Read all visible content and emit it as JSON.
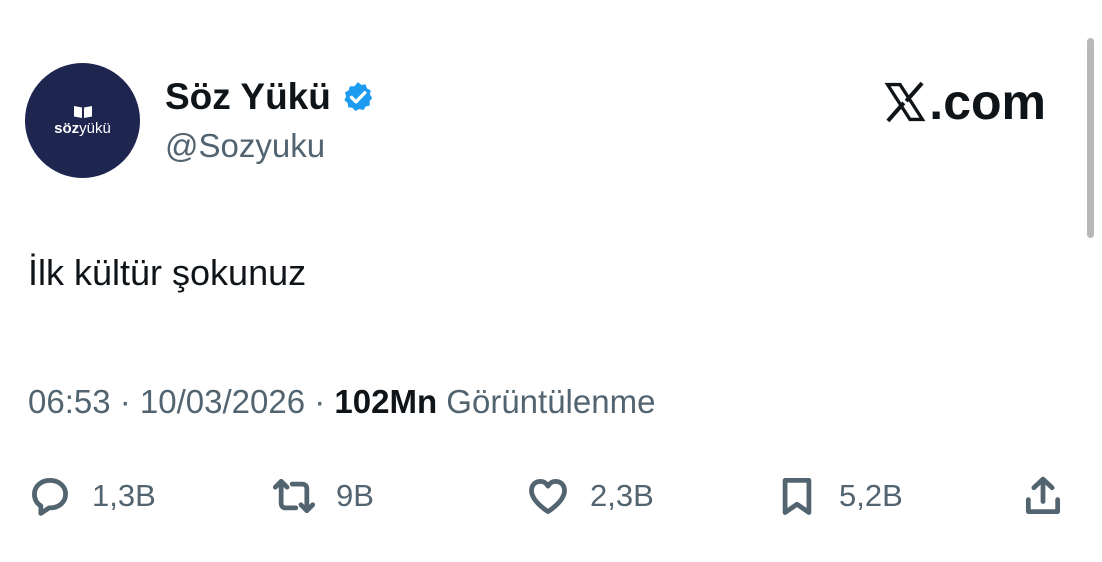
{
  "account": {
    "avatar_text_bold": "söz",
    "avatar_text_light": "yükü",
    "display_name": "Söz Yükü",
    "handle": "@Sozyuku",
    "verified": true
  },
  "brand": {
    "label": ".com"
  },
  "tweet": {
    "text": "İlk kültür şokunuz"
  },
  "meta": {
    "time": "06:53",
    "separator": " · ",
    "date": "10/03/2026",
    "views_count": "102Mn",
    "views_label": " Görüntülenme"
  },
  "actions": {
    "replies": "1,3B",
    "reposts": "9B",
    "likes": "2,3B",
    "bookmarks": "5,2B"
  },
  "colors": {
    "avatar_bg": "#1e2650",
    "verified_blue": "#1d9bf0",
    "secondary_text": "#536471",
    "primary_text": "#0f1419"
  }
}
